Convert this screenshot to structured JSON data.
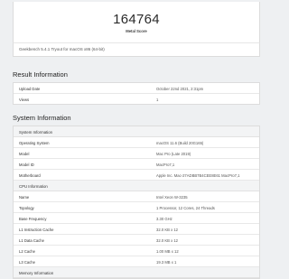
{
  "score": {
    "value": "164764",
    "label": "Metal Score"
  },
  "subtitle": "Geekbench 5.4.1 Tryout for macOS x86 (64-bit)",
  "result_information": {
    "title": "Result Information",
    "rows": [
      {
        "key": "Upload Date",
        "value": "October 22nd 2021, 2:31pm"
      },
      {
        "key": "Views",
        "value": "1"
      }
    ]
  },
  "system_information": {
    "title": "System Information",
    "groups": [
      {
        "header": "System Information",
        "rows": [
          {
            "key": "Operating System",
            "value": "macOS 11.6 (Build 20G165)"
          },
          {
            "key": "Model",
            "value": "Mac Pro (Late 2019)"
          },
          {
            "key": "Model ID",
            "value": "MacPro7,1"
          },
          {
            "key": "Motherboard",
            "value": "Apple Inc. Mac-27ADBB7B4CEE8E61 MacPro7,1"
          }
        ]
      },
      {
        "header": "CPU Information",
        "rows": [
          {
            "key": "Name",
            "value": "Intel Xeon W-3235"
          },
          {
            "key": "Topology",
            "value": "1 Processor, 12 Cores, 24 Threads"
          },
          {
            "key": "Base Frequency",
            "value": "3.30 GHz"
          },
          {
            "key": "L1 Instruction Cache",
            "value": "32.0 KB x 12"
          },
          {
            "key": "L1 Data Cache",
            "value": "32.0 KB x 12"
          },
          {
            "key": "L2 Cache",
            "value": "1.00 MB x 12"
          },
          {
            "key": "L3 Cache",
            "value": "19.3 MB x 1"
          }
        ]
      },
      {
        "header": "Memory Information",
        "rows": []
      }
    ]
  }
}
